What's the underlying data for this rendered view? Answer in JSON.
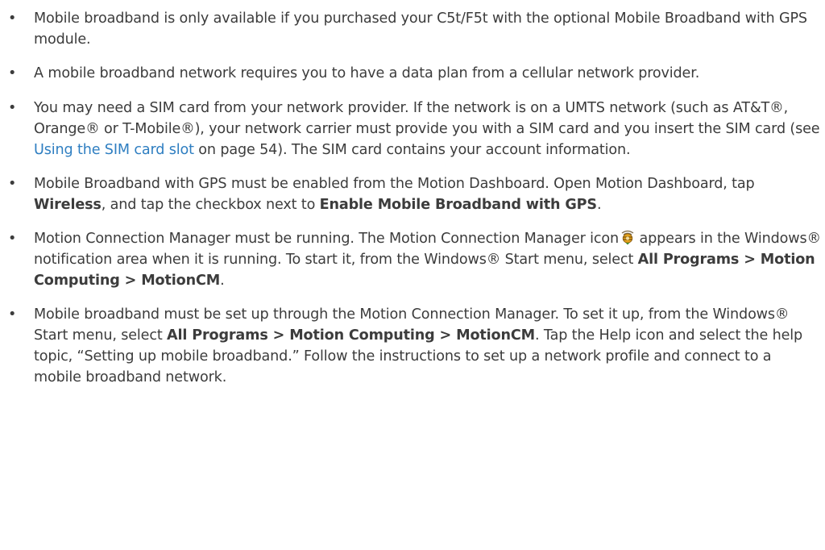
{
  "items": [
    {
      "t1": "Mobile broadband is only available if you purchased your C5t/F5t with the optional Mobile Broadband with GPS module."
    },
    {
      "t1": "A mobile broadband network requires you to have a data plan from a cellular network provider."
    },
    {
      "t1": "You may need a SIM card from your network provider. If the network is on a UMTS network (such as AT&T®, Orange® or T-Mobile®), your network carrier must provide you with a SIM card and you insert the SIM card (see ",
      "link": "Using the SIM card slot",
      "t2": " on page 54). The SIM card contains your account information."
    },
    {
      "t1": "Mobile Broadband with GPS must be enabled from the Motion Dashboard. Open Motion Dashboard, tap ",
      "b1": "Wireless",
      "t2": ", and tap the checkbox next to ",
      "b2": "Enable Mobile Broadband with GPS",
      "t3": "."
    },
    {
      "t1": "Motion Connection Manager must be running. The Motion Connection Manager icon",
      "icon": "motion-connection-manager-icon",
      "t2": " appears in the Windows® notification area when it is running. To start it, from the Windows® Start menu, select ",
      "b1": "All Programs > Motion Computing > MotionCM",
      "t3": "."
    },
    {
      "t1": "Mobile broadband must be set up through the Motion Connection Manager. To set it up, from the Windows® Start menu, select ",
      "b1": "All Programs > Motion Computing > MotionCM",
      "t2": ". Tap the Help icon and select the help topic, “Setting up mobile broadband.” Follow the instructions to set up a network profile and connect to a mobile broadband network."
    }
  ],
  "colors": {
    "text": "#3c3c3c",
    "link": "#2e7ec1"
  }
}
